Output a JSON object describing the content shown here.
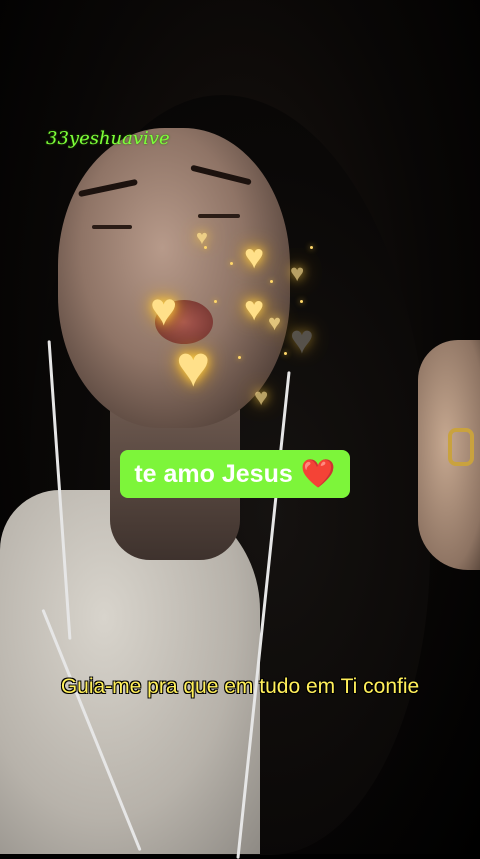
{
  "watermark": {
    "text": "33yeshuavive"
  },
  "caption": {
    "text": "te amo Jesus",
    "emoji": "❤️"
  },
  "subtitle": {
    "text": "Guia-me pra que em tudo em Ti confie"
  },
  "colors": {
    "caption_background": "#7df53a",
    "caption_text": "#ffffff",
    "subtitle_text": "#ffef5a",
    "watermark_text": "#7dff3a",
    "heart_glow": "#ffd24a"
  },
  "icons": {
    "caption_emoji": "red-heart-icon",
    "overlay": "golden-heart-icon"
  }
}
